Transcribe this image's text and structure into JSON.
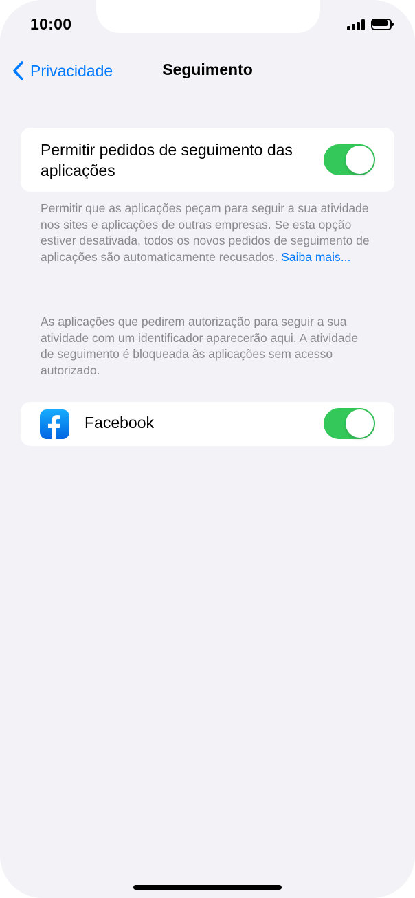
{
  "status_bar": {
    "time": "10:00",
    "signal_icon": "cellular-signal-icon",
    "battery_icon": "battery-icon"
  },
  "nav": {
    "back_label": "Privacidade",
    "title": "Seguimento",
    "back_icon": "chevron-left-icon"
  },
  "tracking_toggle": {
    "label": "Permitir pedidos de seguimento das aplicações",
    "on": true
  },
  "footnote_1": {
    "text": "Permitir que as aplicações peçam para seguir a sua atividade nos sites e aplicações de outras empresas. Se esta opção estiver desativada, todos os novos pedidos de seguimento de aplicações são automaticamente recusados.",
    "link": "Saiba mais..."
  },
  "footnote_2": {
    "text": "As aplicações que pedirem autorização para seguir a sua atividade com um identificador aparecerão aqui. A atividade de seguimento é bloqueada às aplicações sem acesso autorizado."
  },
  "apps": [
    {
      "name": "Facebook",
      "icon": "facebook-icon",
      "on": true
    }
  ],
  "colors": {
    "accent": "#007aff",
    "toggle_on": "#34c759",
    "background": "#f2f2f7",
    "footnote": "#8a8a8e"
  }
}
